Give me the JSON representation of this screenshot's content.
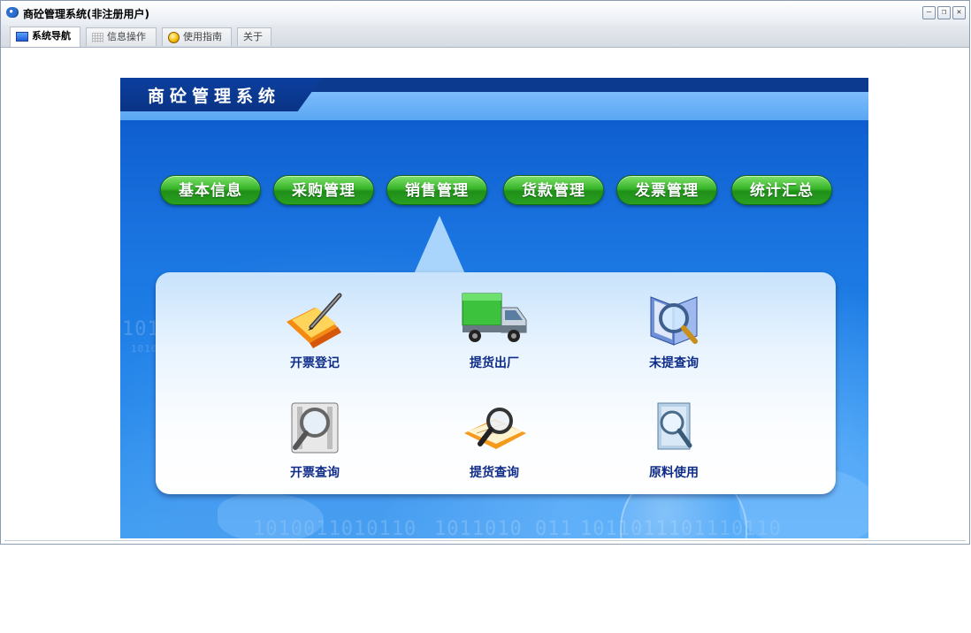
{
  "window": {
    "title": "商砼管理系统(非注册用户)"
  },
  "tabs": [
    {
      "label": "系统导航",
      "icon": "monitor-icon"
    },
    {
      "label": "信息操作",
      "icon": "grid-icon"
    },
    {
      "label": "使用指南",
      "icon": "gold-coin-icon"
    },
    {
      "label": "关于"
    }
  ],
  "banner": {
    "title": "商砼管理系统",
    "binary": [
      "1010011101",
      "1011010",
      "011",
      "10110111011010",
      "1010",
      "1010",
      "1010011010110",
      "1011010  011",
      "1011011101110110"
    ]
  },
  "menu": [
    "基本信息",
    "采购管理",
    "销售管理",
    "货款管理",
    "发票管理",
    "统计汇总"
  ],
  "selected_menu": "销售管理",
  "panel_items": [
    {
      "label": "开票登记",
      "icon": "folder-pen-icon"
    },
    {
      "label": "提货出厂",
      "icon": "truck-icon"
    },
    {
      "label": "未提查询",
      "icon": "book-magnifier-icon"
    },
    {
      "label": "开票查询",
      "icon": "film-magnifier-icon"
    },
    {
      "label": "提货查询",
      "icon": "notebook-magnifier-icon"
    },
    {
      "label": "原料使用",
      "icon": "document-magnifier-icon"
    }
  ],
  "colors": {
    "menu_green": "#2aa022",
    "banner_blue": "#1a74e0",
    "label_blue": "#0f2c88"
  }
}
